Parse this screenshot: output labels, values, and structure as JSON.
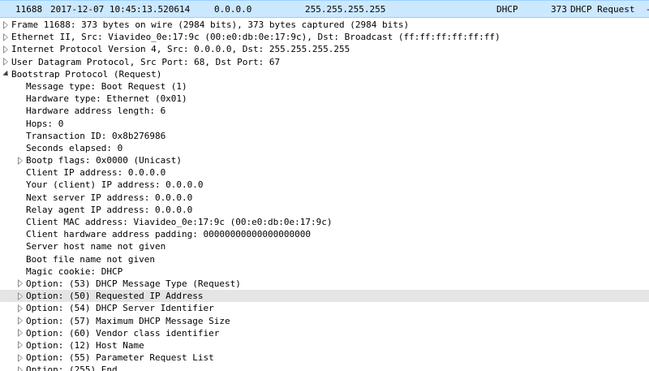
{
  "packet_list": {
    "selected_row": {
      "no": "11688",
      "time": "2017-12-07 10:45:13.520614",
      "source": "0.0.0.0",
      "destination": "255.255.255.255",
      "protocol": "DHCP",
      "length": "373",
      "info": "DHCP Request  -"
    }
  },
  "details": {
    "top_level": [
      {
        "label": "Frame 11688: 373 bytes on wire (2984 bits), 373 bytes captured (2984 bits)",
        "expanded": false
      },
      {
        "label": "Ethernet II, Src: Viavideo_0e:17:9c (00:e0:db:0e:17:9c), Dst: Broadcast (ff:ff:ff:ff:ff:ff)",
        "expanded": false
      },
      {
        "label": "Internet Protocol Version 4, Src: 0.0.0.0, Dst: 255.255.255.255",
        "expanded": false
      },
      {
        "label": "User Datagram Protocol, Src Port: 68, Dst Port: 67",
        "expanded": false
      },
      {
        "label": "Bootstrap Protocol (Request)",
        "expanded": true
      }
    ],
    "bootp_fields": [
      {
        "label": "Message type: Boot Request (1)",
        "expandable": false
      },
      {
        "label": "Hardware type: Ethernet (0x01)",
        "expandable": false
      },
      {
        "label": "Hardware address length: 6",
        "expandable": false
      },
      {
        "label": "Hops: 0",
        "expandable": false
      },
      {
        "label": "Transaction ID: 0x8b276986",
        "expandable": false
      },
      {
        "label": "Seconds elapsed: 0",
        "expandable": false
      },
      {
        "label": "Bootp flags: 0x0000 (Unicast)",
        "expandable": true
      },
      {
        "label": "Client IP address: 0.0.0.0",
        "expandable": false
      },
      {
        "label": "Your (client) IP address: 0.0.0.0",
        "expandable": false
      },
      {
        "label": "Next server IP address: 0.0.0.0",
        "expandable": false
      },
      {
        "label": "Relay agent IP address: 0.0.0.0",
        "expandable": false
      },
      {
        "label": "Client MAC address: Viavideo_0e:17:9c (00:e0:db:0e:17:9c)",
        "expandable": false
      },
      {
        "label": "Client hardware address padding: 00000000000000000000",
        "expandable": false
      },
      {
        "label": "Server host name not given",
        "expandable": false
      },
      {
        "label": "Boot file name not given",
        "expandable": false
      },
      {
        "label": "Magic cookie: DHCP",
        "expandable": false
      },
      {
        "label": "Option: (53) DHCP Message Type (Request)",
        "expandable": true
      },
      {
        "label": "Option: (50) Requested IP Address",
        "expandable": true,
        "hovered": true
      },
      {
        "label": "Option: (54) DHCP Server Identifier",
        "expandable": true
      },
      {
        "label": "Option: (57) Maximum DHCP Message Size",
        "expandable": true
      },
      {
        "label": "Option: (60) Vendor class identifier",
        "expandable": true
      },
      {
        "label": "Option: (12) Host Name",
        "expandable": true
      },
      {
        "label": "Option: (55) Parameter Request List",
        "expandable": true
      },
      {
        "label": "Option: (255) End",
        "expandable": true
      }
    ]
  },
  "colors": {
    "selected_row_bg": "#cce8ff",
    "hover_row_bg": "#e5e5e5"
  }
}
